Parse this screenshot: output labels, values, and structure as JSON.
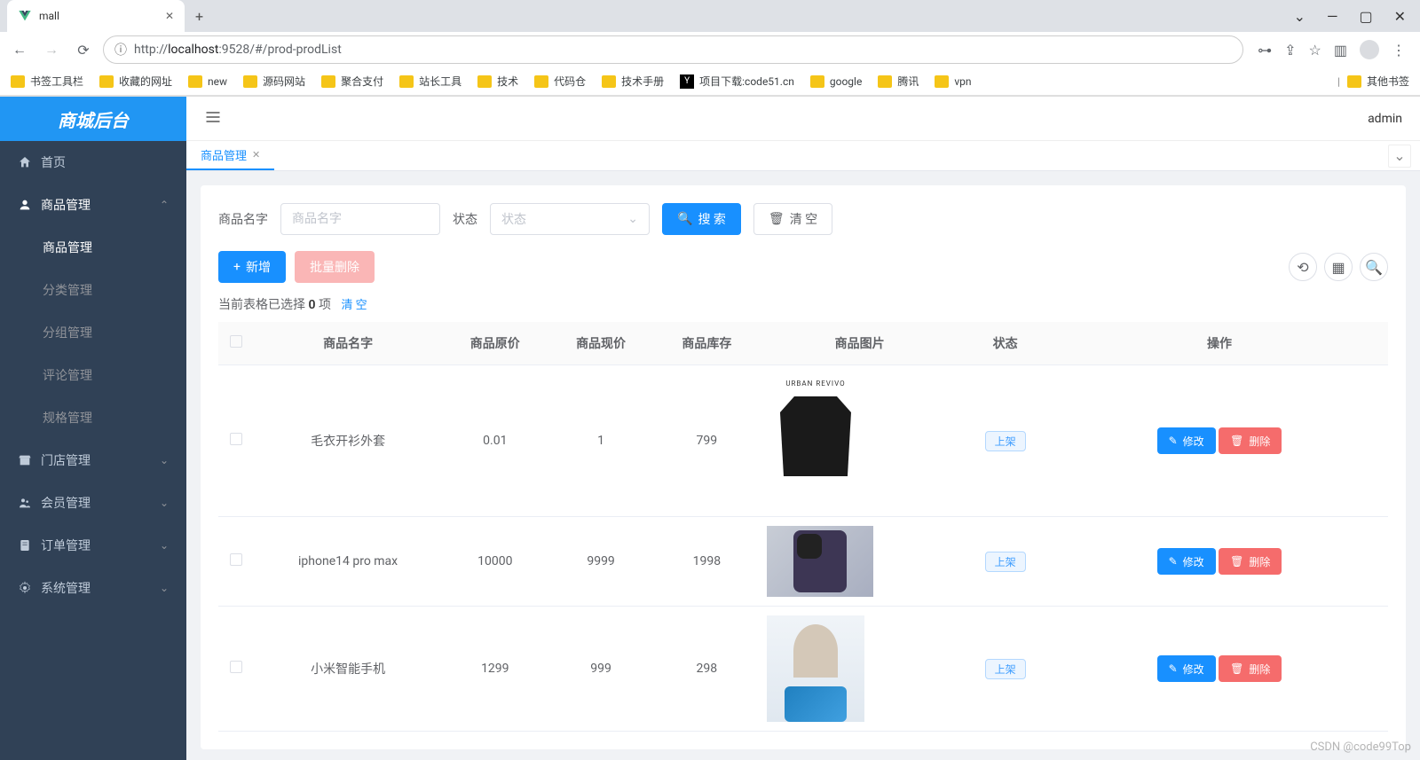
{
  "browser": {
    "tab_title": "mall",
    "url_info_icon": "ⓘ",
    "url_prefix": "http://",
    "url_host": "localhost",
    "url_port": ":9528",
    "url_path": "/#/prod-prodList",
    "bookmarks": [
      "书签工具栏",
      "收藏的网址",
      "new",
      "源码网站",
      "聚合支付",
      "站长工具",
      "技术",
      "代码仓",
      "技术手册",
      "项目下载:code51.cn",
      "google",
      "腾讯",
      "vpn"
    ],
    "other_bookmarks": "其他书签"
  },
  "app": {
    "logo": "商城后台",
    "user": "admin",
    "sidebar": {
      "home": "首页",
      "product_mgmt": "商品管理",
      "submenu": [
        "商品管理",
        "分类管理",
        "分组管理",
        "评论管理",
        "规格管理"
      ],
      "store_mgmt": "门店管理",
      "member_mgmt": "会员管理",
      "order_mgmt": "订单管理",
      "system_mgmt": "系统管理"
    },
    "tabs": {
      "active": "商品管理"
    },
    "filter": {
      "name_label": "商品名字",
      "name_placeholder": "商品名字",
      "status_label": "状态",
      "status_placeholder": "状态",
      "search_btn": "搜 索",
      "clear_btn": "清 空"
    },
    "actions": {
      "add_btn": "新增",
      "batch_delete_btn": "批量删除"
    },
    "selection": {
      "prefix": "当前表格已选择 ",
      "count": "0",
      "suffix": " 项",
      "clear": "清 空"
    },
    "table": {
      "headers": [
        "",
        "商品名字",
        "商品原价",
        "商品现价",
        "商品库存",
        "商品图片",
        "状态",
        "操作"
      ],
      "edit_btn": "修改",
      "delete_btn": "删除",
      "status_tag": "上架",
      "rows": [
        {
          "name": "毛衣开衫外套",
          "orig": "0.01",
          "now": "1",
          "stock": "799",
          "img_type": "jacket",
          "img_label": "URBAN REVIVO"
        },
        {
          "name": "iphone14 pro max",
          "orig": "10000",
          "now": "9999",
          "stock": "1998",
          "img_type": "phone"
        },
        {
          "name": "小米智能手机",
          "orig": "1299",
          "now": "999",
          "stock": "298",
          "img_type": "xiaomi"
        }
      ]
    }
  },
  "watermark": "CSDN @code99Top"
}
